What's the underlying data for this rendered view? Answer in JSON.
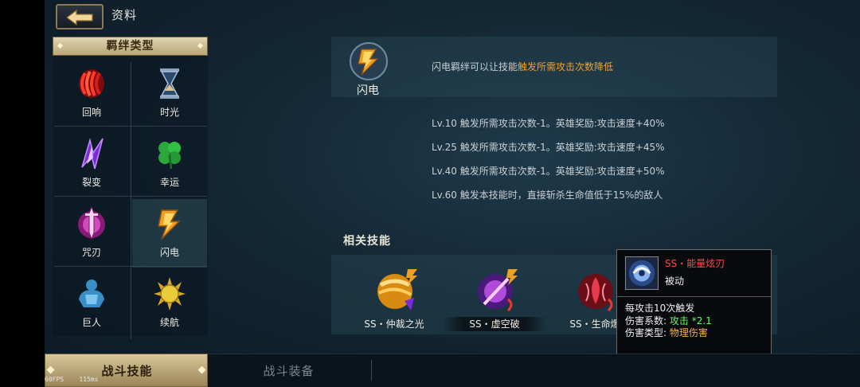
{
  "header": {
    "title": "资料",
    "back_icon": "back-arrow-icon"
  },
  "bond_panel": {
    "title": "羁绊类型",
    "items": [
      {
        "label": "回响",
        "icon": "echo-icon"
      },
      {
        "label": "时光",
        "icon": "hourglass-icon"
      },
      {
        "label": "裂变",
        "icon": "fission-icon"
      },
      {
        "label": "幸运",
        "icon": "clover-icon"
      },
      {
        "label": "咒刃",
        "icon": "cursed-blade-icon"
      },
      {
        "label": "闪电",
        "icon": "lightning-icon",
        "selected": true
      },
      {
        "label": "巨人",
        "icon": "giant-icon"
      },
      {
        "label": "续航",
        "icon": "sun-icon"
      }
    ]
  },
  "bond_detail": {
    "name": "闪电",
    "desc_prefix": "闪电羁绊可以让技能",
    "desc_highlight": "触发所需攻击次数降低",
    "highlight_color": "#f0a030",
    "levels": [
      "Lv.10  触发所需攻击次数-1。英雄奖励:攻击速度+40%",
      "Lv.25  触发所需攻击次数-1。英雄奖励:攻击速度+45%",
      "Lv.40  触发所需攻击次数-1。英雄奖励:攻击速度+50%",
      "Lv.60  触发本技能时，直接斩杀生命值低于15%的敌人"
    ]
  },
  "related": {
    "title": "相关技能",
    "skills": [
      {
        "name": "SS・仲裁之光"
      },
      {
        "name": "SS・虚空破"
      },
      {
        "name": "SS・生命爆"
      }
    ]
  },
  "tooltip": {
    "name": "SS・能量炫刃",
    "type": "被动",
    "trigger": "每攻击10次触发",
    "coef_label": "伤害系数:",
    "coef_value": "攻击 *2.1",
    "dmg_label": "伤害类型:",
    "dmg_value": "物理伤害"
  },
  "tabs": {
    "active": "战斗技能",
    "other": "战斗装备"
  },
  "debug": {
    "fps": "60FPS",
    "ms": "115ms"
  }
}
